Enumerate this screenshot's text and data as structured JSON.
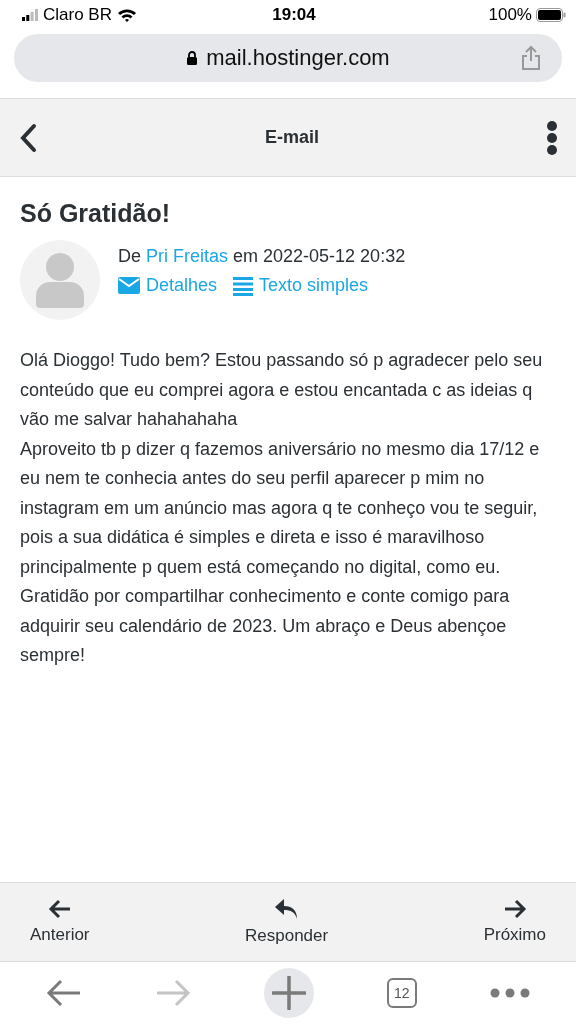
{
  "status_bar": {
    "carrier": "Claro BR",
    "time": "19:04",
    "battery": "100%"
  },
  "address_bar": {
    "url": "mail.hostinger.com"
  },
  "header": {
    "title": "E-mail"
  },
  "message": {
    "subject": "Só Gratidão!",
    "from_prefix": "De",
    "sender": "Pri Freitas",
    "date_text": "em 2022-05-12 20:32",
    "links": [
      {
        "kind": "details",
        "label": "Detalhes"
      },
      {
        "kind": "plain",
        "label": "Texto simples"
      }
    ],
    "paragraphs": [
      "Olá Dioggo! Tudo bem? Estou passando só p agradecer pelo seu conteúdo que eu comprei agora e estou encantada c as ideias q vão me salvar hahahahaha",
      "Aproveito tb p dizer q fazemos aniversário no mesmo dia 17/12 e eu nem te conhecia antes do seu perfil aparecer p mim no instagram em um anúncio mas agora q te conheço vou te seguir, pois a sua didática é simples e direta e isso é maravilhoso principalmente p quem está começando no digital, como eu.",
      "Gratidão por compartilhar conhecimento e conte comigo para adquirir seu calendário de 2023. Um abraço e Deus abençoe sempre!"
    ]
  },
  "actions": [
    {
      "kind": "previous",
      "label": "Anterior"
    },
    {
      "kind": "reply",
      "label": "Responder"
    },
    {
      "kind": "next",
      "label": "Próximo"
    }
  ],
  "browser_toolbar": {
    "back_disabled": false,
    "forward_disabled": true,
    "tab_count": "12"
  }
}
